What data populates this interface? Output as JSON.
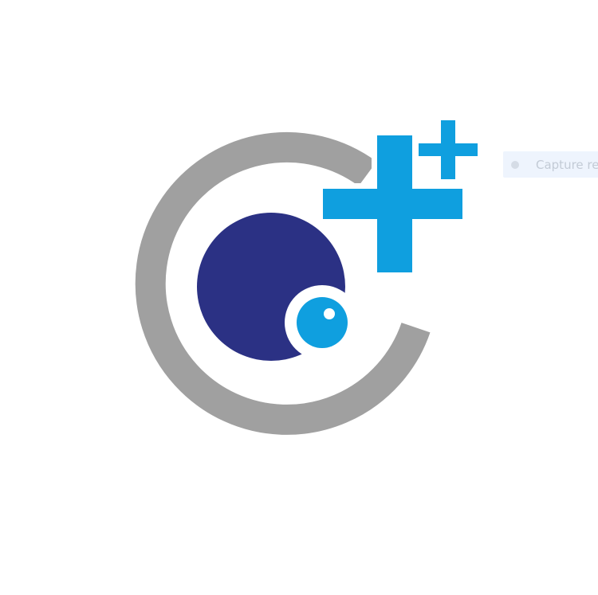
{
  "logo": {
    "name": "camera-plus-logo",
    "colors": {
      "ring": "#a0a0a0",
      "lens": "#2b3184",
      "highlight": "#0f9fdf",
      "plus": "#0f9fdf",
      "background": "#ffffff"
    }
  },
  "capture_button": {
    "label": "Capture re",
    "icon": "record-dot-icon",
    "colors": {
      "background": "#eef4fd",
      "text": "#c3cbd6",
      "dot": "#d5dce6"
    }
  }
}
